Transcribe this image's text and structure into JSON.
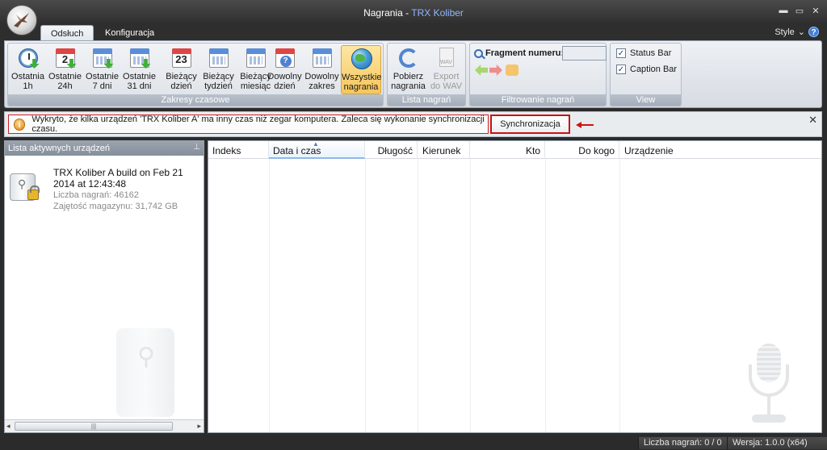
{
  "window": {
    "title_main": "Nagrania - ",
    "title_brand": "TRX Koliber",
    "controls": [
      "minimize-icon",
      "maximize-icon",
      "close-icon"
    ]
  },
  "tabs": [
    {
      "label": "Odsłuch",
      "active": true
    },
    {
      "label": "Konfiguracja",
      "active": false
    }
  ],
  "style_menu": {
    "label": "Style",
    "help": "?"
  },
  "ribbon": {
    "groups": {
      "time_ranges": "Zakresy czasowe",
      "recordings_list": "Lista nagrań",
      "filtering": "Filtrowanie nagrań",
      "view": "View"
    },
    "time_buttons": [
      {
        "line1": "Ostatnia",
        "line2": "1h",
        "icon": "clock-icon"
      },
      {
        "line1": "Ostatnie",
        "line2": "24h",
        "icon": "calendar-24-icon"
      },
      {
        "line1": "Ostatnie",
        "line2": "7 dni",
        "icon": "calendar-week-icon"
      },
      {
        "line1": "Ostatnie",
        "line2": "31 dni",
        "icon": "calendar-month-icon"
      },
      {
        "line1": "Bieżący",
        "line2": "dzień",
        "icon": "calendar-day-icon",
        "day_number": "23"
      },
      {
        "line1": "Bieżący",
        "line2": "tydzień",
        "icon": "calendar-week-icon"
      },
      {
        "line1": "Bieżący",
        "line2": "miesiąc",
        "icon": "calendar-month-icon"
      },
      {
        "line1": "Dowolny",
        "line2": "dzień",
        "icon": "calendar-question-icon",
        "question": "?"
      },
      {
        "line1": "Dowolny",
        "line2": "zakres",
        "icon": "calendar-range-icon"
      },
      {
        "line1": "Wszystkie",
        "line2": "nagrania",
        "icon": "globe-icon",
        "selected": true
      }
    ],
    "list_buttons": [
      {
        "line1": "Pobierz",
        "line2": "nagrania",
        "icon": "refresh-icon"
      },
      {
        "line1": "Export",
        "line2": "do WAV",
        "icon": "wav-file-icon",
        "disabled": true,
        "badge": "WAV"
      }
    ],
    "filter": {
      "label": "Fragment numeru:",
      "value": ""
    },
    "view": [
      {
        "label": "Status Bar",
        "checked": true
      },
      {
        "label": "Caption Bar",
        "checked": true
      }
    ]
  },
  "notification": {
    "message": "Wykryto, że kilka urządzeń 'TRX Koliber A' ma inny czas niż zegar komputera. Zaleca się wykonanie synchronizacji czasu.",
    "button": "Synchronizacja",
    "info": "i",
    "close": "✕"
  },
  "devices_panel": {
    "title": "Lista aktywnych urządzeń",
    "devices": [
      {
        "name": "TRX Koliber A build on Feb 21 2014 at 12:43:48",
        "recordings": "Liczba nagrań: 46162",
        "storage": "Zajętość magazynu: 31,742 GB"
      }
    ]
  },
  "table": {
    "columns": [
      "Indeks",
      "Data i czas",
      "Długość",
      "Kierunek",
      "Kto",
      "Do kogo",
      "Urządzenie"
    ],
    "sorted_column": "Data i czas",
    "rows": []
  },
  "statusbar": {
    "count": "Liczba nagrań: 0 / 0",
    "version": "Wersja: 1.0.0 (x64)"
  }
}
